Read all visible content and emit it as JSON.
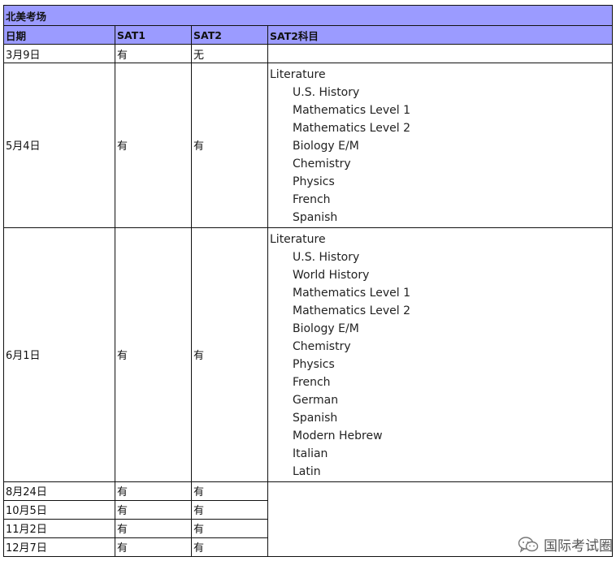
{
  "table": {
    "region": "北美考场",
    "headers": [
      "日期",
      "SAT1",
      "SAT2",
      "SAT2科目"
    ],
    "rows": [
      {
        "date": "3月9日",
        "sat1": "有",
        "sat2": "无",
        "subjects": []
      },
      {
        "date": "5月4日",
        "sat1": "有",
        "sat2": "有",
        "subjects": [
          "Literature",
          "U.S. History",
          "Mathematics Level 1",
          "Mathematics Level 2",
          "Biology E/M",
          "Chemistry",
          "Physics",
          "French",
          "Spanish"
        ]
      },
      {
        "date": "6月1日",
        "sat1": "有",
        "sat2": "有",
        "subjects": [
          "Literature",
          "U.S. History",
          "World History",
          "Mathematics Level 1",
          "Mathematics Level 2",
          "Biology E/M",
          "Chemistry",
          "Physics",
          "French",
          "German",
          "Spanish",
          "Modern Hebrew",
          "Italian",
          "Latin"
        ]
      },
      {
        "date": "8月24日",
        "sat1": "有",
        "sat2": "有"
      },
      {
        "date": "10月5日",
        "sat1": "有",
        "sat2": "有"
      },
      {
        "date": "11月2日",
        "sat1": "有",
        "sat2": "有"
      },
      {
        "date": "12月7日",
        "sat1": "有",
        "sat2": "有"
      }
    ]
  },
  "watermark": {
    "text": "国际考试圈",
    "icon": "wechat-icon"
  }
}
